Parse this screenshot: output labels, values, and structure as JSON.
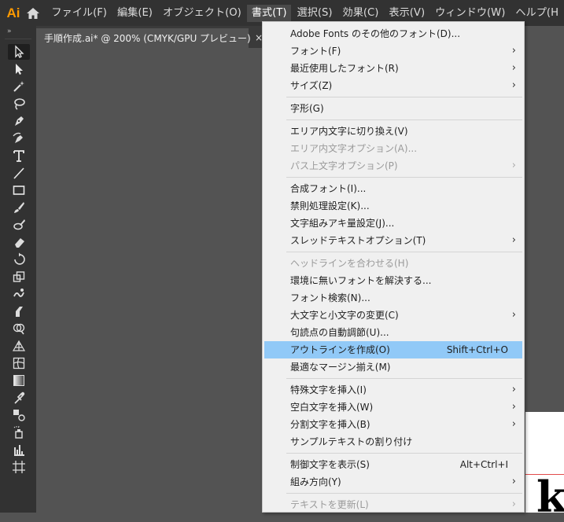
{
  "menubar": {
    "logo": "Ai",
    "items": [
      "ファイル(F)",
      "編集(E)",
      "オブジェクト(O)",
      "書式(T)",
      "選択(S)",
      "効果(C)",
      "表示(V)",
      "ウィンドウ(W)",
      "ヘルプ(H"
    ],
    "active_index": 3
  },
  "document": {
    "tab_title": "手順作成.ai* @ 200% (CMYK/GPU プレビュー)",
    "close_glyph": "×"
  },
  "toolbar": {
    "grip": "»",
    "tools": [
      "selection-tool",
      "direct-selection-tool",
      "magic-wand-tool",
      "lasso-tool",
      "pen-tool",
      "curvature-tool",
      "type-tool",
      "line-tool",
      "rectangle-tool",
      "paintbrush-tool",
      "blob-brush-tool",
      "eraser-tool",
      "rotate-tool",
      "scale-tool",
      "warp-tool",
      "puppet-warp-tool",
      "shape-builder-tool",
      "perspective-grid-tool",
      "mesh-tool",
      "gradient-tool",
      "eyedropper-tool",
      "blend-tool",
      "symbol-sprayer-tool",
      "column-graph-tool",
      "artboard-tool"
    ],
    "selected_index": 0
  },
  "type_menu": {
    "groups": [
      [
        {
          "label": "Adobe Fonts のその他のフォント(D)...",
          "shortcut": "",
          "submenu": false,
          "disabled": false
        },
        {
          "label": "フォント(F)",
          "shortcut": "",
          "submenu": true,
          "disabled": false
        },
        {
          "label": "最近使用したフォント(R)",
          "shortcut": "",
          "submenu": true,
          "disabled": false
        },
        {
          "label": "サイズ(Z)",
          "shortcut": "",
          "submenu": true,
          "disabled": false
        }
      ],
      [
        {
          "label": "字形(G)",
          "shortcut": "",
          "submenu": false,
          "disabled": false
        }
      ],
      [
        {
          "label": "エリア内文字に切り換え(V)",
          "shortcut": "",
          "submenu": false,
          "disabled": false
        },
        {
          "label": "エリア内文字オプション(A)...",
          "shortcut": "",
          "submenu": false,
          "disabled": true
        },
        {
          "label": "パス上文字オプション(P)",
          "shortcut": "",
          "submenu": true,
          "disabled": true
        }
      ],
      [
        {
          "label": "合成フォント(I)...",
          "shortcut": "",
          "submenu": false,
          "disabled": false
        },
        {
          "label": "禁則処理設定(K)...",
          "shortcut": "",
          "submenu": false,
          "disabled": false
        },
        {
          "label": "文字組みアキ量設定(J)...",
          "shortcut": "",
          "submenu": false,
          "disabled": false
        },
        {
          "label": "スレッドテキストオプション(T)",
          "shortcut": "",
          "submenu": true,
          "disabled": false
        }
      ],
      [
        {
          "label": "ヘッドラインを合わせる(H)",
          "shortcut": "",
          "submenu": false,
          "disabled": true
        },
        {
          "label": "環境に無いフォントを解決する...",
          "shortcut": "",
          "submenu": false,
          "disabled": false
        },
        {
          "label": "フォント検索(N)...",
          "shortcut": "",
          "submenu": false,
          "disabled": false
        },
        {
          "label": "大文字と小文字の変更(C)",
          "shortcut": "",
          "submenu": true,
          "disabled": false
        },
        {
          "label": "句読点の自動調節(U)...",
          "shortcut": "",
          "submenu": false,
          "disabled": false
        },
        {
          "label": "アウトラインを作成(O)",
          "shortcut": "Shift+Ctrl+O",
          "submenu": false,
          "disabled": false,
          "highlighted": true
        },
        {
          "label": "最適なマージン揃え(M)",
          "shortcut": "",
          "submenu": false,
          "disabled": false
        }
      ],
      [
        {
          "label": "特殊文字を挿入(I)",
          "shortcut": "",
          "submenu": true,
          "disabled": false
        },
        {
          "label": "空白文字を挿入(W)",
          "shortcut": "",
          "submenu": true,
          "disabled": false
        },
        {
          "label": "分割文字を挿入(B)",
          "shortcut": "",
          "submenu": true,
          "disabled": false
        },
        {
          "label": "サンプルテキストの割り付け",
          "shortcut": "",
          "submenu": false,
          "disabled": false
        }
      ],
      [
        {
          "label": "制御文字を表示(S)",
          "shortcut": "Alt+Ctrl+I",
          "submenu": false,
          "disabled": false
        },
        {
          "label": "組み方向(Y)",
          "shortcut": "",
          "submenu": true,
          "disabled": false
        }
      ],
      [
        {
          "label": "テキストを更新(L)",
          "shortcut": "",
          "submenu": true,
          "disabled": true
        }
      ]
    ],
    "submenu_arrow": "›"
  },
  "artboard": {
    "glyph": "k"
  },
  "colors": {
    "accent_logo": "#ff9a00",
    "menu_highlight": "#91c9f7",
    "chrome_dark": "#323232",
    "canvas": "#535353"
  }
}
